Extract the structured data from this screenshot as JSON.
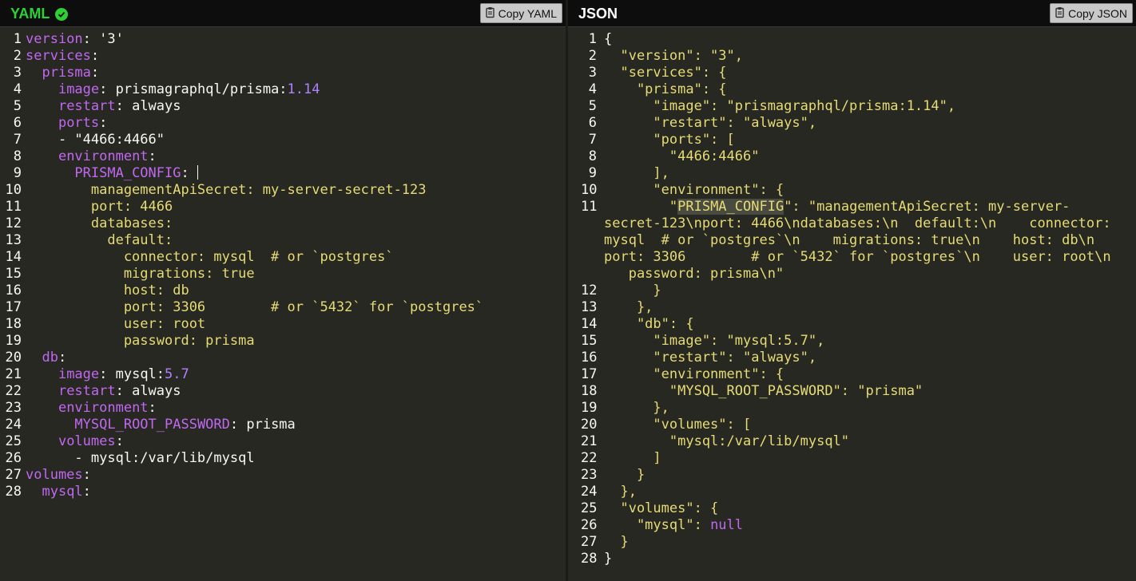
{
  "yaml_panel": {
    "title": "YAML",
    "status_icon": "check-circle-icon",
    "copy_button_label": "Copy YAML",
    "copy_icon": "clipboard-icon"
  },
  "json_panel": {
    "title": "JSON",
    "copy_button_label": "Copy JSON",
    "copy_icon": "clipboard-icon"
  },
  "colors": {
    "background": "#272822",
    "header": "#0d0d0d",
    "yaml_title_ok": "#2ed135",
    "key": "#c168f0",
    "string": "#e6db74",
    "number": "#ae81ff",
    "text": "#f8f8f2"
  },
  "yaml_lines": [
    {
      "n": "1",
      "segs": [
        {
          "t": "version",
          "c": "k"
        },
        {
          "t": ": '3'",
          "c": "p"
        }
      ]
    },
    {
      "n": "2",
      "segs": [
        {
          "t": "services",
          "c": "k"
        },
        {
          "t": ":",
          "c": "p"
        }
      ]
    },
    {
      "n": "3",
      "segs": [
        {
          "t": "  ",
          "c": "p"
        },
        {
          "t": "prisma",
          "c": "k"
        },
        {
          "t": ":",
          "c": "p"
        }
      ]
    },
    {
      "n": "4",
      "segs": [
        {
          "t": "    ",
          "c": "p"
        },
        {
          "t": "image",
          "c": "k"
        },
        {
          "t": ": prismagraphql/prisma:",
          "c": "p"
        },
        {
          "t": "1.14",
          "c": "n"
        }
      ]
    },
    {
      "n": "5",
      "segs": [
        {
          "t": "    ",
          "c": "p"
        },
        {
          "t": "restart",
          "c": "k"
        },
        {
          "t": ": always",
          "c": "p"
        }
      ]
    },
    {
      "n": "6",
      "segs": [
        {
          "t": "    ",
          "c": "p"
        },
        {
          "t": "ports",
          "c": "k"
        },
        {
          "t": ":",
          "c": "p"
        }
      ]
    },
    {
      "n": "7",
      "segs": [
        {
          "t": "    - \"4466:4466\"",
          "c": "p"
        }
      ]
    },
    {
      "n": "8",
      "segs": [
        {
          "t": "    ",
          "c": "p"
        },
        {
          "t": "environment",
          "c": "k"
        },
        {
          "t": ":",
          "c": "p"
        }
      ]
    },
    {
      "n": "9",
      "segs": [
        {
          "t": "      ",
          "c": "p"
        },
        {
          "t": "PRISMA_CONFIG",
          "c": "k"
        },
        {
          "t": ": ",
          "c": "p"
        },
        {
          "t": "|",
          "c": "cursor"
        }
      ]
    },
    {
      "n": "10",
      "segs": [
        {
          "t": "        managementApiSecret: my-server-secret-123",
          "c": "s"
        }
      ]
    },
    {
      "n": "11",
      "segs": [
        {
          "t": "        port: 4466",
          "c": "s"
        }
      ]
    },
    {
      "n": "12",
      "segs": [
        {
          "t": "        databases:",
          "c": "s"
        }
      ]
    },
    {
      "n": "13",
      "segs": [
        {
          "t": "          default:",
          "c": "s"
        }
      ]
    },
    {
      "n": "14",
      "segs": [
        {
          "t": "            connector: mysql  # or `postgres`",
          "c": "s"
        }
      ]
    },
    {
      "n": "15",
      "segs": [
        {
          "t": "            migrations: true",
          "c": "s"
        }
      ]
    },
    {
      "n": "16",
      "segs": [
        {
          "t": "            host: db",
          "c": "s"
        }
      ]
    },
    {
      "n": "17",
      "segs": [
        {
          "t": "            port: 3306        # or `5432` for `postgres`",
          "c": "s"
        }
      ]
    },
    {
      "n": "18",
      "segs": [
        {
          "t": "            user: root",
          "c": "s"
        }
      ]
    },
    {
      "n": "19",
      "segs": [
        {
          "t": "            password: prisma",
          "c": "s"
        }
      ]
    },
    {
      "n": "20",
      "segs": [
        {
          "t": "  ",
          "c": "p"
        },
        {
          "t": "db",
          "c": "k"
        },
        {
          "t": ":",
          "c": "p"
        }
      ]
    },
    {
      "n": "21",
      "segs": [
        {
          "t": "    ",
          "c": "p"
        },
        {
          "t": "image",
          "c": "k"
        },
        {
          "t": ": mysql:",
          "c": "p"
        },
        {
          "t": "5.7",
          "c": "n"
        }
      ]
    },
    {
      "n": "22",
      "segs": [
        {
          "t": "    ",
          "c": "p"
        },
        {
          "t": "restart",
          "c": "k"
        },
        {
          "t": ": always",
          "c": "p"
        }
      ]
    },
    {
      "n": "23",
      "segs": [
        {
          "t": "    ",
          "c": "p"
        },
        {
          "t": "environment",
          "c": "k"
        },
        {
          "t": ":",
          "c": "p"
        }
      ]
    },
    {
      "n": "24",
      "segs": [
        {
          "t": "      ",
          "c": "p"
        },
        {
          "t": "MYSQL_ROOT_PASSWORD",
          "c": "k"
        },
        {
          "t": ": prisma",
          "c": "p"
        }
      ]
    },
    {
      "n": "25",
      "segs": [
        {
          "t": "    ",
          "c": "p"
        },
        {
          "t": "volumes",
          "c": "k"
        },
        {
          "t": ":",
          "c": "p"
        }
      ]
    },
    {
      "n": "26",
      "segs": [
        {
          "t": "      - mysql:/var/lib/mysql",
          "c": "p"
        }
      ]
    },
    {
      "n": "27",
      "segs": [
        {
          "t": "volumes",
          "c": "k"
        },
        {
          "t": ":",
          "c": "p"
        }
      ]
    },
    {
      "n": "28",
      "segs": [
        {
          "t": "  ",
          "c": "p"
        },
        {
          "t": "mysql",
          "c": "k"
        },
        {
          "t": ":",
          "c": "p"
        }
      ]
    }
  ],
  "json_lines": [
    {
      "n": "1",
      "segs": [
        {
          "t": "{",
          "c": "p"
        }
      ]
    },
    {
      "n": "2",
      "segs": [
        {
          "t": "  \"version\": \"3\",",
          "c": "s"
        }
      ]
    },
    {
      "n": "3",
      "segs": [
        {
          "t": "  \"services\": {",
          "c": "s"
        }
      ]
    },
    {
      "n": "4",
      "segs": [
        {
          "t": "    \"prisma\": {",
          "c": "s"
        }
      ]
    },
    {
      "n": "5",
      "segs": [
        {
          "t": "      \"image\": \"prismagraphql/prisma:1.14\",",
          "c": "s"
        }
      ]
    },
    {
      "n": "6",
      "segs": [
        {
          "t": "      \"restart\": \"always\",",
          "c": "s"
        }
      ]
    },
    {
      "n": "7",
      "segs": [
        {
          "t": "      \"ports\": [",
          "c": "s"
        }
      ]
    },
    {
      "n": "8",
      "segs": [
        {
          "t": "        \"4466:4466\"",
          "c": "s"
        }
      ]
    },
    {
      "n": "9",
      "segs": [
        {
          "t": "      ],",
          "c": "s"
        }
      ]
    },
    {
      "n": "10",
      "segs": [
        {
          "t": "      \"environment\": {",
          "c": "s"
        }
      ]
    },
    {
      "n": "11",
      "wrap": true,
      "segs": [
        {
          "t": "        \"",
          "c": "s"
        },
        {
          "t": "PRISMA_CONFIG",
          "c": "s hl"
        },
        {
          "t": "\": \"managementApiSecret: my-server-\n",
          "c": "s"
        },
        {
          "t": "secret-123\\nport: 4466\\ndatabases:\\n  default:\\n    connector:\n",
          "c": "s"
        },
        {
          "t": "mysql  # or `postgres`\\n    migrations: true\\n    host: db\\n\n",
          "c": "s"
        },
        {
          "t": "port: 3306        # or `5432` for `postgres`\\n    user: root\\n\n",
          "c": "s"
        },
        {
          "t": "   password: prisma\\n\"",
          "c": "s"
        }
      ]
    },
    {
      "n": "12",
      "segs": [
        {
          "t": "      }",
          "c": "s"
        }
      ]
    },
    {
      "n": "13",
      "segs": [
        {
          "t": "    },",
          "c": "s"
        }
      ]
    },
    {
      "n": "14",
      "segs": [
        {
          "t": "    \"db\": {",
          "c": "s"
        }
      ]
    },
    {
      "n": "15",
      "segs": [
        {
          "t": "      \"image\": \"mysql:5.7\",",
          "c": "s"
        }
      ]
    },
    {
      "n": "16",
      "segs": [
        {
          "t": "      \"restart\": \"always\",",
          "c": "s"
        }
      ]
    },
    {
      "n": "17",
      "segs": [
        {
          "t": "      \"environment\": {",
          "c": "s"
        }
      ]
    },
    {
      "n": "18",
      "segs": [
        {
          "t": "        \"MYSQL_ROOT_PASSWORD\": \"prisma\"",
          "c": "s"
        }
      ]
    },
    {
      "n": "19",
      "segs": [
        {
          "t": "      },",
          "c": "s"
        }
      ]
    },
    {
      "n": "20",
      "segs": [
        {
          "t": "      \"volumes\": [",
          "c": "s"
        }
      ]
    },
    {
      "n": "21",
      "segs": [
        {
          "t": "        \"mysql:/var/lib/mysql\"",
          "c": "s"
        }
      ]
    },
    {
      "n": "22",
      "segs": [
        {
          "t": "      ]",
          "c": "s"
        }
      ]
    },
    {
      "n": "23",
      "segs": [
        {
          "t": "    }",
          "c": "s"
        }
      ]
    },
    {
      "n": "24",
      "segs": [
        {
          "t": "  },",
          "c": "s"
        }
      ]
    },
    {
      "n": "25",
      "segs": [
        {
          "t": "  \"volumes\": {",
          "c": "s"
        }
      ]
    },
    {
      "n": "26",
      "segs": [
        {
          "t": "    \"mysql\": ",
          "c": "s"
        },
        {
          "t": "null",
          "c": "k"
        }
      ]
    },
    {
      "n": "27",
      "segs": [
        {
          "t": "  }",
          "c": "s"
        }
      ]
    },
    {
      "n": "28",
      "segs": [
        {
          "t": "}",
          "c": "p"
        }
      ]
    }
  ]
}
